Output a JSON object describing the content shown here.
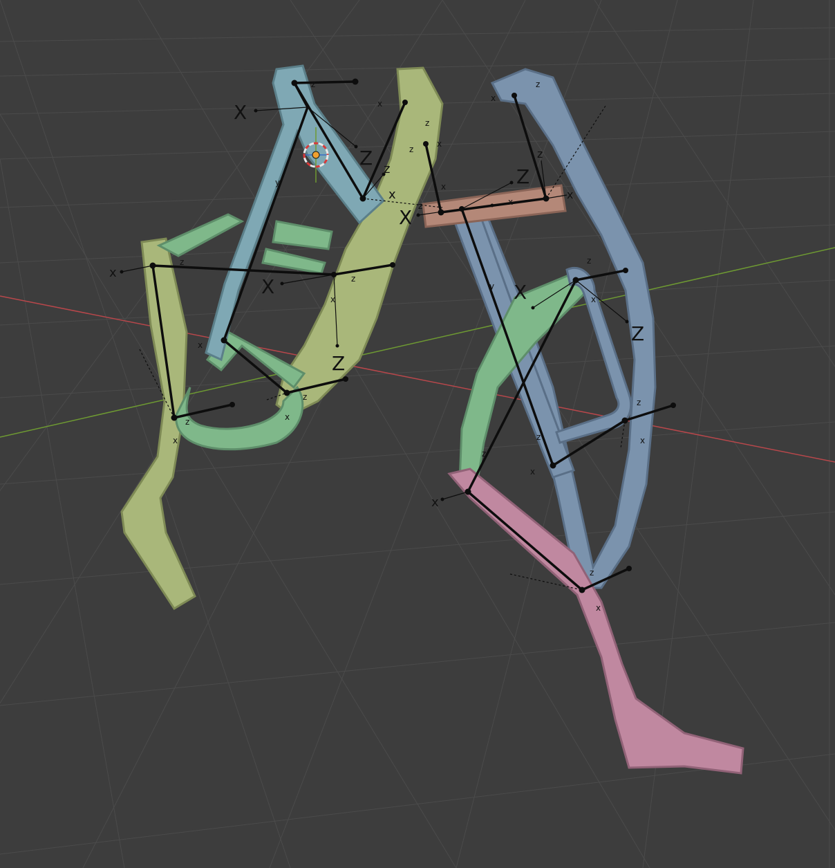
{
  "viewport": {
    "background": "#3d3d3d",
    "grid_color": "#4a4a4a",
    "x_axis_color": "#b8474b",
    "y_axis_color": "#6e9a32"
  },
  "parts": [
    {
      "name": "left-thigh-bar",
      "color": "#7fa8b4"
    },
    {
      "name": "left-foot-plate",
      "color": "#a9b77a"
    },
    {
      "name": "left-link-ring",
      "color": "#7fb88a"
    },
    {
      "name": "right-thigh-bar",
      "color": "#7b93ad"
    },
    {
      "name": "right-hip-crossbar",
      "color": "#b48878"
    },
    {
      "name": "right-link-ring",
      "color": "#7fb88a"
    },
    {
      "name": "right-foot-plate",
      "color": "#c088a0"
    }
  ],
  "labels": {
    "x": "X",
    "z": "Z",
    "x_small": "x",
    "z_small": "z",
    "y_small": "y"
  },
  "bone_color": "#0d0d0d",
  "cursor": {
    "name": "3d-cursor",
    "ring_color": "#e8e8e8",
    "accent_color": "#d83a3a",
    "center_color": "#f0a030"
  }
}
